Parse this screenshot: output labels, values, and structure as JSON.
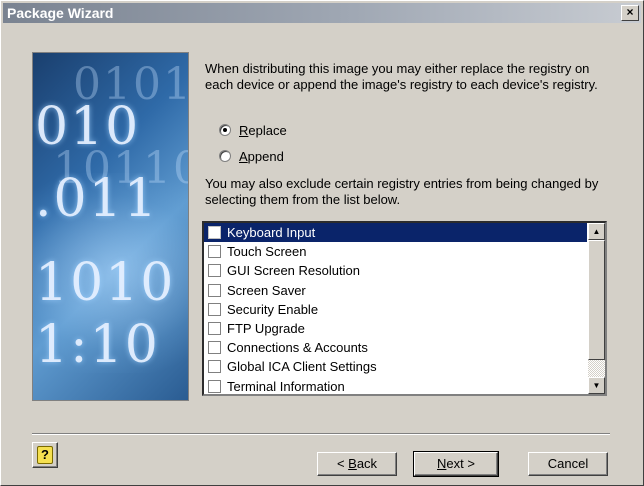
{
  "window": {
    "title": "Package Wizard",
    "close_glyph": "×"
  },
  "banner": {
    "rows": [
      "010",
      ".011",
      "1010",
      "1:10"
    ],
    "faint_rows": [
      "0101",
      "10110"
    ],
    "colors": {
      "dark": "#1a3f6e",
      "light": "#5f9bd0"
    }
  },
  "registry": {
    "description": "When distributing this image you may either replace the registry on each device or append the image's registry to each device's registry.",
    "options": [
      {
        "label": "Replace",
        "selected": true
      },
      {
        "label": "Append",
        "selected": false
      }
    ]
  },
  "exclude": {
    "description": "You may also exclude certain registry entries from being changed by selecting them from the list below.",
    "items": [
      {
        "label": "Keyboard Input",
        "checked": false,
        "selected": true
      },
      {
        "label": "Touch Screen",
        "checked": false,
        "selected": false
      },
      {
        "label": "GUI Screen Resolution",
        "checked": false,
        "selected": false
      },
      {
        "label": "Screen Saver",
        "checked": false,
        "selected": false
      },
      {
        "label": "Security Enable",
        "checked": false,
        "selected": false
      },
      {
        "label": "FTP Upgrade",
        "checked": false,
        "selected": false
      },
      {
        "label": "Connections & Accounts",
        "checked": false,
        "selected": false
      },
      {
        "label": "Global ICA Client Settings",
        "checked": false,
        "selected": false
      },
      {
        "label": "Terminal Information",
        "checked": false,
        "selected": false
      }
    ],
    "scroll_up_glyph": "▲",
    "scroll_down_glyph": "▼"
  },
  "buttons": {
    "help": "?",
    "back_prefix": "< ",
    "back_key": "B",
    "back_rest": "ack",
    "next_key": "N",
    "next_rest": "ext >",
    "cancel": "Cancel"
  },
  "colors": {
    "selection": "#0a246a",
    "face": "#d4d0c8"
  }
}
